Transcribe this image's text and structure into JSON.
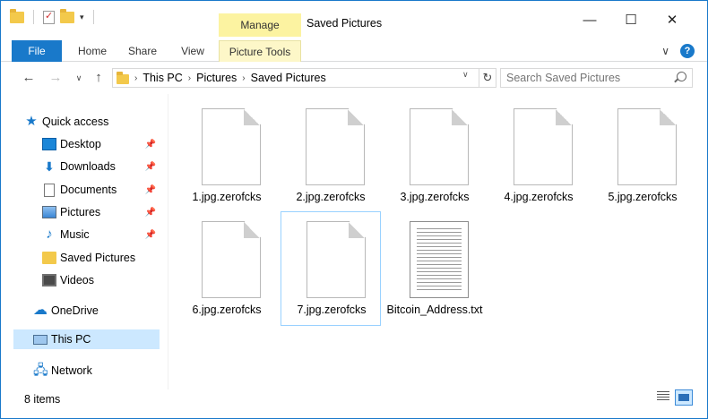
{
  "window": {
    "title": "Saved Pictures",
    "context_tab_group": "Manage",
    "minimize": "—",
    "maximize": "☐",
    "close": "✕"
  },
  "ribbon": {
    "tabs": [
      "File",
      "Home",
      "Share",
      "View",
      "Picture Tools"
    ],
    "expand": "∨",
    "help": "?"
  },
  "address": {
    "back": "←",
    "forward": "→",
    "dropdown": "∨",
    "up": "↑",
    "breadcrumb": [
      "This PC",
      "Pictures",
      "Saved Pictures"
    ],
    "separator": "›",
    "refresh": "↻",
    "search_placeholder": "Search Saved Pictures"
  },
  "nav": {
    "quick_access": "Quick access",
    "items": [
      {
        "label": "Desktop",
        "icon": "desktop-icon",
        "pinned": true
      },
      {
        "label": "Downloads",
        "icon": "downloads-icon",
        "pinned": true
      },
      {
        "label": "Documents",
        "icon": "documents-icon",
        "pinned": true
      },
      {
        "label": "Pictures",
        "icon": "pictures-icon",
        "pinned": true
      },
      {
        "label": "Music",
        "icon": "music-icon",
        "pinned": true
      },
      {
        "label": "Saved Pictures",
        "icon": "folder-icon",
        "pinned": false
      },
      {
        "label": "Videos",
        "icon": "videos-icon",
        "pinned": false
      }
    ],
    "onedrive": "OneDrive",
    "this_pc": "This PC",
    "network": "Network",
    "pin_glyph": "📌"
  },
  "files": [
    {
      "name": "1.jpg.zerofcks"
    },
    {
      "name": "2.jpg.zerofcks"
    },
    {
      "name": "3.jpg.zerofcks"
    },
    {
      "name": "4.jpg.zerofcks"
    },
    {
      "name": "5.jpg.zerofcks"
    },
    {
      "name": "6.jpg.zerofcks"
    },
    {
      "name": "7.jpg.zerofcks",
      "selected": true
    },
    {
      "name": "Bitcoin_Address.txt",
      "type": "text"
    }
  ],
  "status": {
    "item_count": "8 items"
  },
  "colors": {
    "accent": "#1979ca",
    "manage_tab": "#fcf3a1",
    "selection": "#cce8ff"
  }
}
